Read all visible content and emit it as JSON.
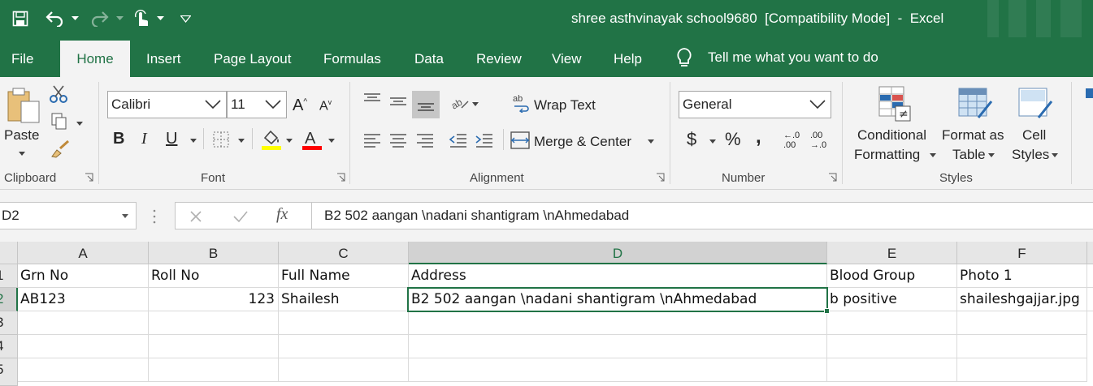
{
  "window": {
    "title": "shree asthvinayak school9680  [Compatibility Mode]  -  Excel"
  },
  "quick_access": {
    "icons": [
      "save-icon",
      "undo-icon",
      "redo-icon",
      "touch-mode-icon",
      "customize-qat-icon"
    ]
  },
  "tabs": [
    {
      "label": "File"
    },
    {
      "label": "Home"
    },
    {
      "label": "Insert"
    },
    {
      "label": "Page Layout"
    },
    {
      "label": "Formulas"
    },
    {
      "label": "Data"
    },
    {
      "label": "Review"
    },
    {
      "label": "View"
    },
    {
      "label": "Help"
    }
  ],
  "tell_me": "Tell me what you want to do",
  "ribbon": {
    "clipboard": {
      "paste": "Paste",
      "group": "Clipboard"
    },
    "font": {
      "name": "Calibri",
      "size": "11",
      "group": "Font",
      "fill_color": "#ffff00",
      "font_color": "#ff0000",
      "bold": "B",
      "italic": "I",
      "underline": "U"
    },
    "alignment": {
      "wrap": "Wrap Text",
      "merge": "Merge & Center",
      "group": "Alignment"
    },
    "number": {
      "format": "General",
      "currency": "$",
      "percent": "%",
      "comma": ",",
      "group": "Number",
      "inc_decimal_top": "←.0",
      "inc_decimal_bottom": ".00",
      "dec_decimal_top": ".00",
      "dec_decimal_bottom": "→.0"
    },
    "styles": {
      "conditional_1": "Conditional",
      "conditional_2": "Formatting",
      "table_1": "Format as",
      "table_2": "Table",
      "cell_1": "Cell",
      "cell_2": "Styles",
      "group": "Styles"
    }
  },
  "formula_bar": {
    "name_box": "D2",
    "fx": "fx",
    "value": "B2 502 aangan \\nadani shantigram \\nAhmedabad"
  },
  "sheet": {
    "columns": [
      "A",
      "B",
      "C",
      "D",
      "E",
      "F"
    ],
    "rows": [
      "1",
      "2",
      "3",
      "4",
      "5"
    ],
    "cells": {
      "A1": "Grn No",
      "B1": "Roll No",
      "C1": "Full Name",
      "D1": "Address",
      "E1": "Blood Group",
      "F1": "Photo 1",
      "A2": "AB123",
      "B2": "123",
      "C2": "Shailesh",
      "D2": "B2 502 aangan \\nadani shantigram \\nAhmedabad",
      "E2": "b positive",
      "F2": "shaileshgajjar.jpg"
    },
    "active_cell": "D2",
    "accent_color": "#217346"
  }
}
